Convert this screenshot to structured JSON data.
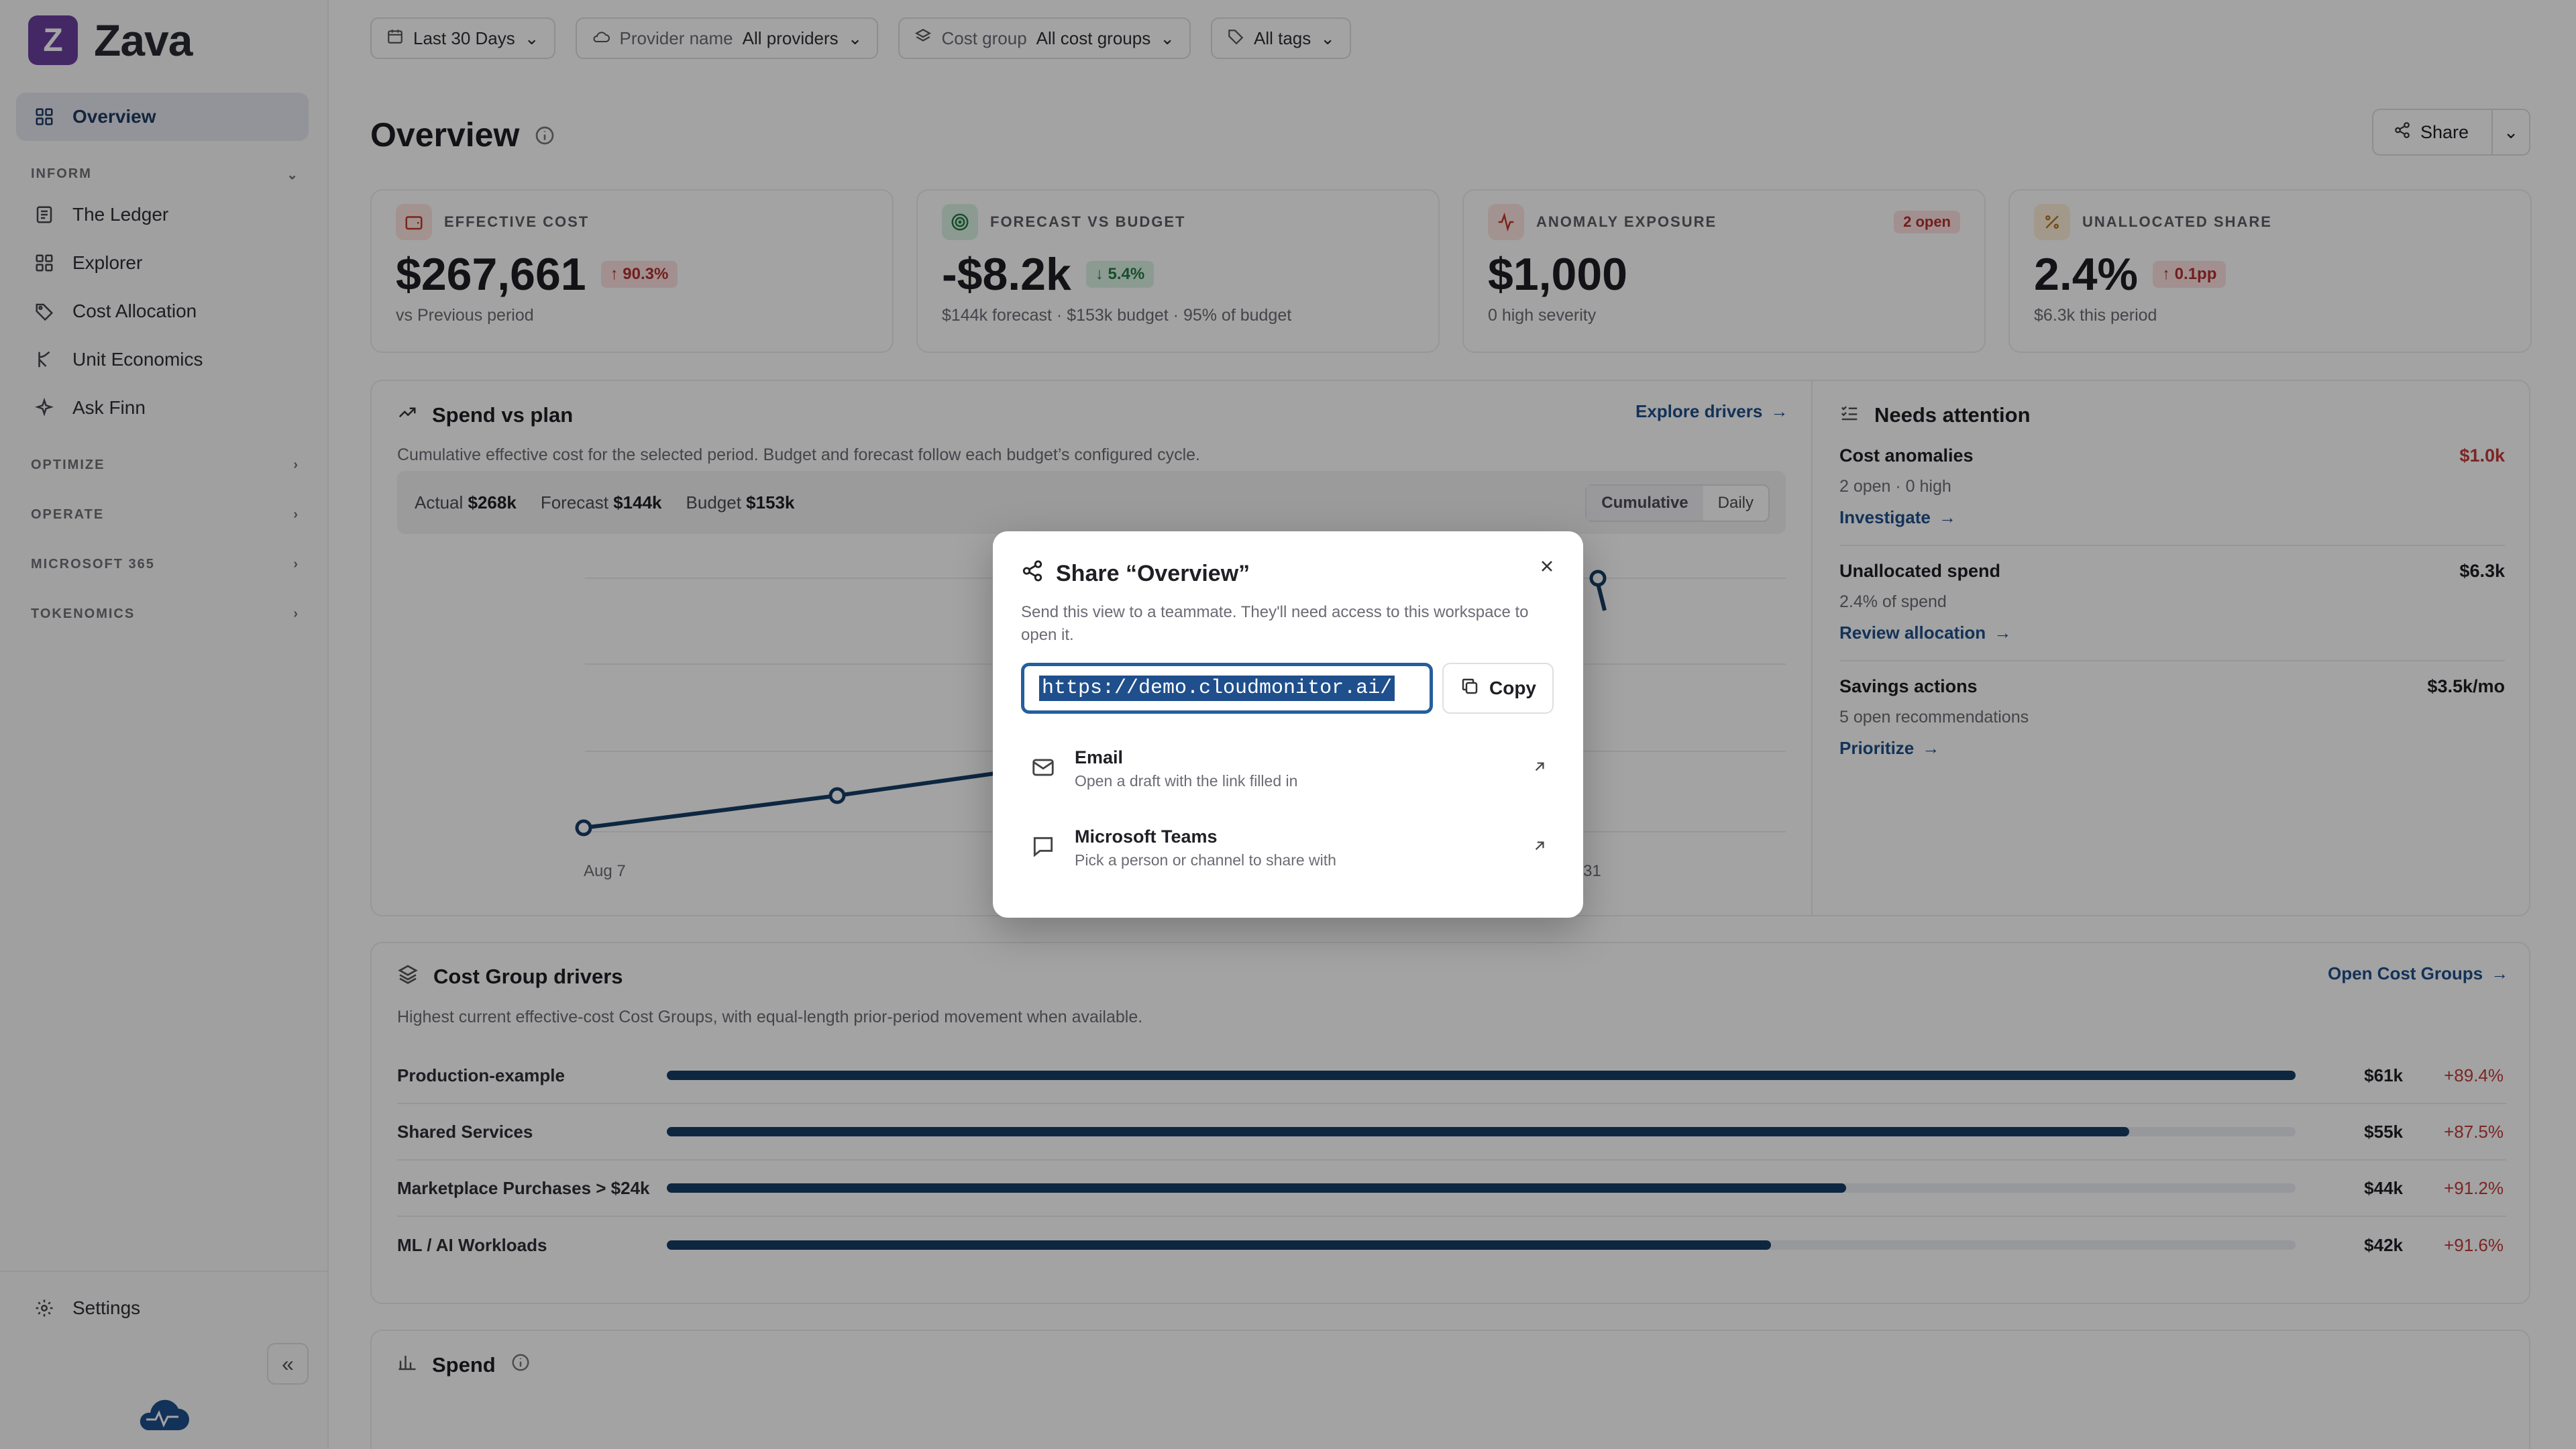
{
  "app": {
    "logo_letter": "Z",
    "name": "Zava"
  },
  "sidebar": {
    "overview": "Overview",
    "sections": {
      "inform": "INFORM",
      "optimize": "OPTIMIZE",
      "operate": "OPERATE",
      "microsoft365": "MICROSOFT 365",
      "tokenomics": "TOKENOMICS"
    },
    "inform_items": [
      {
        "label": "The Ledger",
        "icon": "ledger-icon"
      },
      {
        "label": "Explorer",
        "icon": "grid-icon"
      },
      {
        "label": "Cost Allocation",
        "icon": "tag-icon"
      },
      {
        "label": "Unit Economics",
        "icon": "branch-icon"
      },
      {
        "label": "Ask Finn",
        "icon": "sparkle-icon"
      }
    ],
    "settings": "Settings"
  },
  "filters": {
    "date": "Last 30 Days",
    "provider_label": "Provider name",
    "provider_value": "All providers",
    "costgroup_label": "Cost group",
    "costgroup_value": "All cost groups",
    "tags": "All tags"
  },
  "page": {
    "title": "Overview",
    "share": "Share"
  },
  "kpis": [
    {
      "label": "EFFECTIVE COST",
      "value": "$267,661",
      "delta": "90.3%",
      "sub": "vs Previous period"
    },
    {
      "label": "FORECAST VS BUDGET",
      "value": "-$8.2k",
      "delta": "5.4%",
      "sub": "$144k forecast · $153k budget · 95% of budget"
    },
    {
      "label": "ANOMALY EXPOSURE",
      "value": "$1,000",
      "badge": "2 open",
      "sub": "0 high severity"
    },
    {
      "label": "UNALLOCATED SHARE",
      "value": "2.4%",
      "delta": "0.1pp",
      "sub": "$6.3k this period"
    }
  ],
  "spend_plan": {
    "title": "Spend vs plan",
    "link": "Explore drivers",
    "desc": "Cumulative effective cost for the selected period. Budget and forecast follow each budget’s configured cycle.",
    "actual_label": "Actual",
    "actual": "$268k",
    "forecast_label": "Forecast",
    "forecast": "$144k",
    "budget_label": "Budget",
    "budget": "$153k",
    "toggle": [
      "Cumulative",
      "Daily"
    ],
    "x_start": "Aug 7",
    "x_end": "31"
  },
  "attention": {
    "title": "Needs attention",
    "items": [
      {
        "title": "Cost anomalies",
        "value": "$1.0k",
        "sub": "2 open · 0 high",
        "link": "Investigate"
      },
      {
        "title": "Unallocated spend",
        "value": "$6.3k",
        "sub": "2.4% of spend",
        "link": "Review allocation"
      },
      {
        "title": "Savings actions",
        "value": "$3.5k/mo",
        "sub": "5 open recommendations",
        "link": "Prioritize"
      }
    ]
  },
  "drivers": {
    "title": "Cost Group drivers",
    "link": "Open Cost Groups",
    "desc": "Highest current effective-cost Cost Groups, with equal-length prior-period movement when available.",
    "rows": [
      {
        "name": "Production-example",
        "share": 1.0,
        "amount": "$61k",
        "change": "+89.4%"
      },
      {
        "name": "Shared Services",
        "share": 0.898,
        "amount": "$55k",
        "change": "+87.5%"
      },
      {
        "name": "Marketplace Purchases > $24k",
        "share": 0.724,
        "amount": "$44k",
        "change": "+91.2%"
      },
      {
        "name": "ML / AI Workloads",
        "share": 0.678,
        "amount": "$42k",
        "change": "+91.6%"
      }
    ]
  },
  "spend": {
    "title": "Spend"
  },
  "modal": {
    "title": "Share “Overview”",
    "desc": "Send this view to a teammate. They'll need access to this workspace to open it.",
    "url": "https://demo.cloudmonitor.ai/",
    "copy": "Copy",
    "options": [
      {
        "title": "Email",
        "sub": "Open a draft with the link filled in"
      },
      {
        "title": "Microsoft Teams",
        "sub": "Pick a person or channel to share with"
      }
    ]
  },
  "colors": {
    "accent": "#1f4f8c",
    "brand": "#6b3fa0",
    "bar": "#163e66",
    "danger": "#c23b3b"
  }
}
